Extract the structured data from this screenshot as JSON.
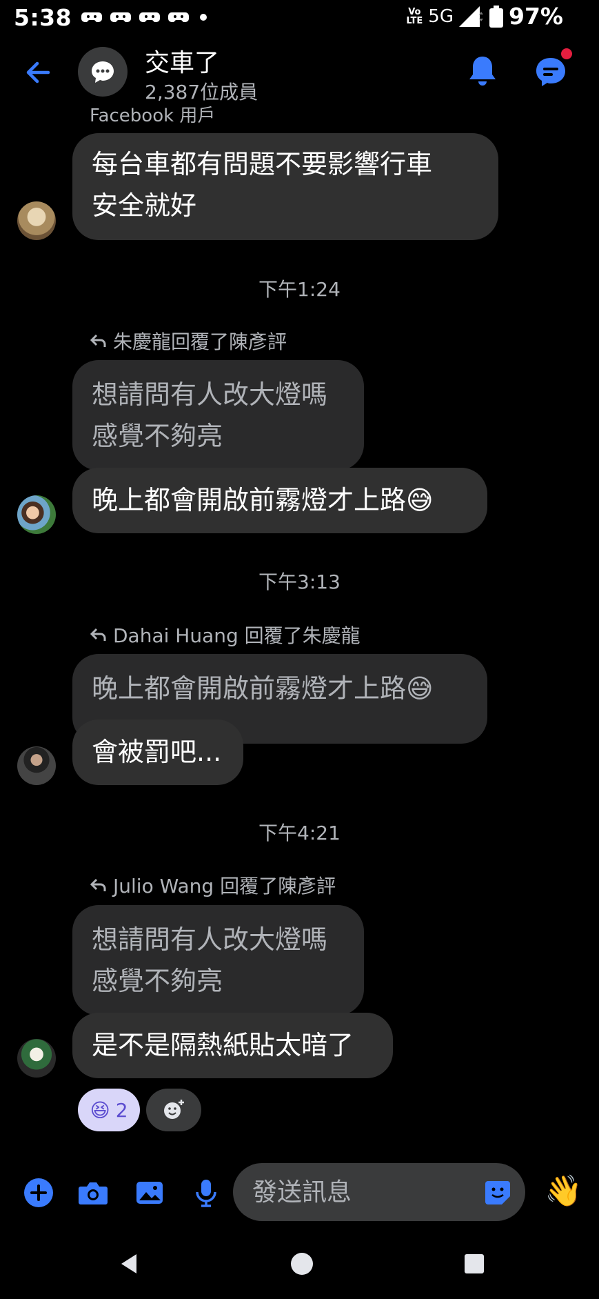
{
  "status_bar": {
    "time": "5:38",
    "volte_top": "Vo",
    "volte_bottom": "LTE",
    "network": "5G",
    "battery": "97%"
  },
  "header": {
    "title": "交車了",
    "subtitle": "2,387位成員"
  },
  "messages": {
    "cut_sender": "Facebook 用戶",
    "m1_line1": "每台車都有問題不要影響行車",
    "m1_line2": "安全就好",
    "time1": "下午1:24",
    "reply1": "朱慶龍回覆了陳彥評",
    "quote1_line1": "想請問有人改大燈嗎",
    "quote1_line2": "感覺不夠亮",
    "m2": "晚上都會開啟前霧燈才上路😅",
    "time2": "下午3:13",
    "reply2": "Dahai Huang 回覆了朱慶龍",
    "quote2": "晚上都會開啟前霧燈才上路😅",
    "m3": "會被罰吧...",
    "time3": "下午4:21",
    "reply3": "Julio Wang 回覆了陳彥評",
    "quote3_line1": "想請問有人改大燈嗎",
    "quote3_line2": "感覺不夠亮",
    "m4": "是不是隔熱紙貼太暗了"
  },
  "reaction": {
    "emoji": "😆",
    "count": "2"
  },
  "composer": {
    "placeholder": "發送訊息",
    "wave": "👋"
  },
  "colors": {
    "accent": "#3a7bfd",
    "bubble": "#303030",
    "background": "#000000",
    "secondary_text": "#b0b3b8",
    "notification_red": "#e41e3f"
  },
  "icons": [
    "back-arrow-icon",
    "bell-icon",
    "messenger-icon",
    "plus-icon",
    "camera-icon",
    "image-icon",
    "microphone-icon",
    "sticker-icon",
    "wave-emoji",
    "nav-back-icon",
    "nav-home-icon",
    "nav-recents-icon"
  ]
}
